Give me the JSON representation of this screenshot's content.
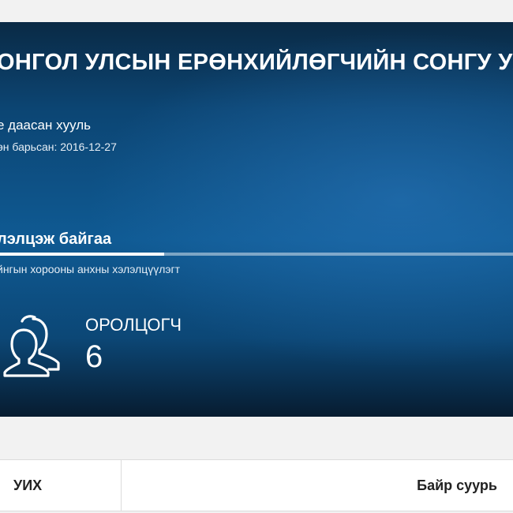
{
  "hero": {
    "title": "ОНГОЛ УЛСЫН ЕРӨНХИЙЛӨГЧИЙН СОНГУ УХАЙ",
    "law_type": "е даасан хууль",
    "submitted": "өн барьсан: 2016-12-27",
    "status": "лэлцэж байгаа",
    "progress_percent": 32,
    "stage": "йнгын хорооны анхны хэлэлцүүлэгт",
    "participants_label": "ОРОЛЦОГЧ",
    "participants_count": "6",
    "icon": "people-icon"
  },
  "table": {
    "left_label": "УИХ",
    "right_label": "Байр суурь"
  },
  "colors": {
    "hero_dark": "#0a2a45",
    "hero_mid": "#0f5a93",
    "page_bg": "#f2f2f2"
  }
}
